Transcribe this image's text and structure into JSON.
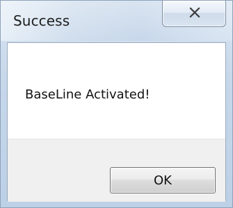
{
  "window": {
    "title": "Success"
  },
  "titlebar": {
    "close_icon": "close-icon"
  },
  "message": {
    "text": "BaseLine Activated!"
  },
  "buttons": {
    "ok_label": "OK"
  },
  "colors": {
    "titlebar_bg": "#c6d7ea",
    "button_bar_bg": "#f0f0f0",
    "text": "#111111"
  }
}
